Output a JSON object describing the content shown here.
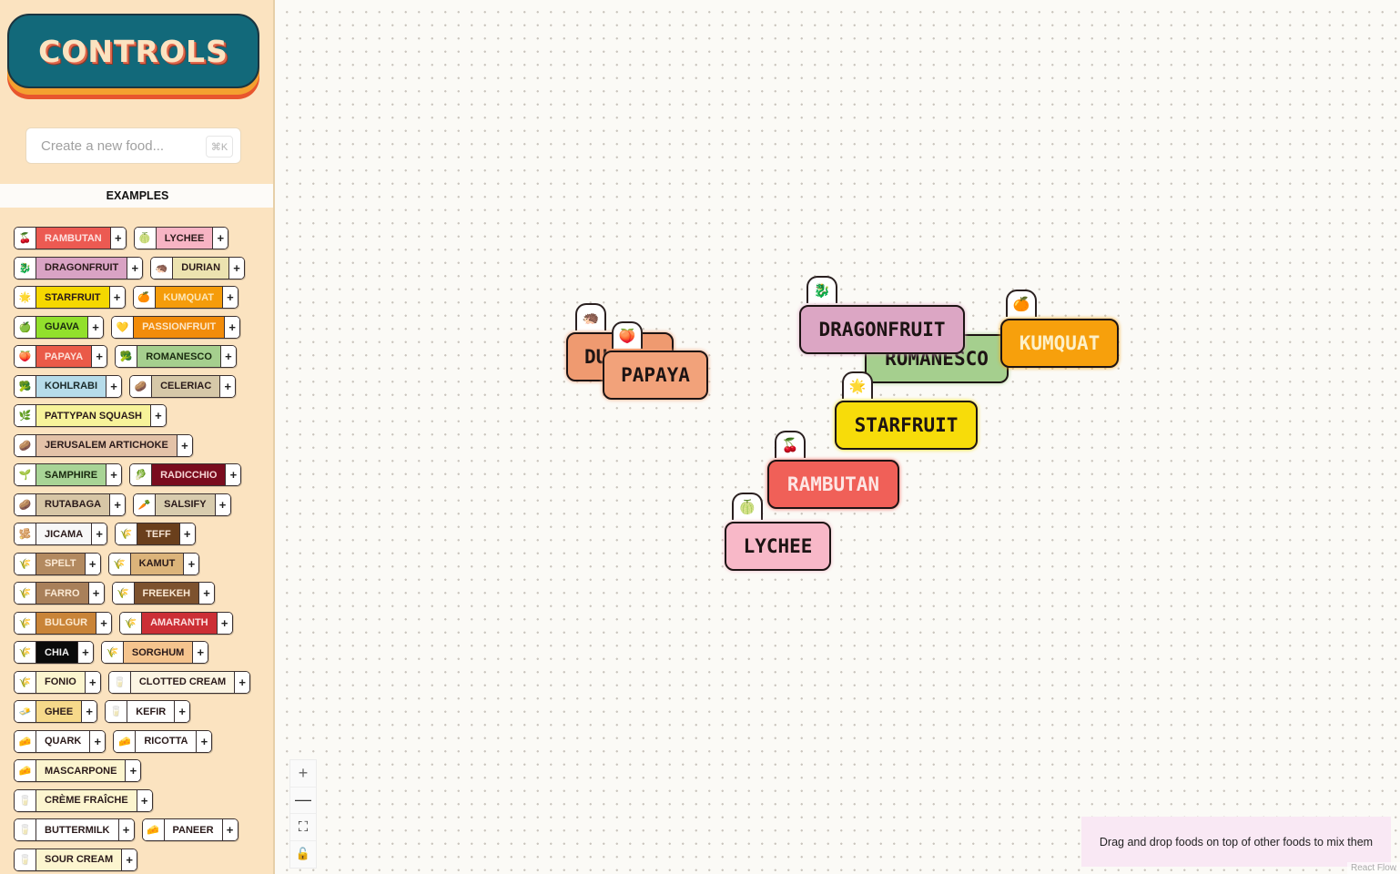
{
  "sidebar": {
    "logo": "CONTROLS",
    "search": {
      "placeholder": "Create a new food...",
      "value": "",
      "shortcut": "⌘K"
    },
    "examples_title": "EXAMPLES",
    "rows": [
      [
        {
          "label": "RAMBUTAN",
          "icon": "cherries-icon",
          "glyph": "🍒",
          "bg": "#ec5a52",
          "fg": "#fde2e0"
        },
        {
          "label": "LYCHEE",
          "icon": "melon-icon",
          "glyph": "🍈",
          "bg": "#f7b4c4",
          "fg": "#2a1a1a"
        }
      ],
      [
        {
          "label": "DRAGONFRUIT",
          "icon": "dragon-icon",
          "glyph": "🐉",
          "bg": "#d9a3c4",
          "fg": "#2a1a1a"
        },
        {
          "label": "DURIAN",
          "icon": "hedgehog-icon",
          "glyph": "🦔",
          "bg": "#ece3b0",
          "fg": "#2a1a1a"
        }
      ],
      [
        {
          "label": "STARFRUIT",
          "icon": "star-icon",
          "glyph": "🌟",
          "bg": "#f5d800",
          "fg": "#2a1a1a"
        },
        {
          "label": "KUMQUAT",
          "icon": "orange-icon",
          "glyph": "🍊",
          "bg": "#f59c0a",
          "fg": "#fde7b8"
        }
      ],
      [
        {
          "label": "GUAVA",
          "icon": "apple-icon",
          "glyph": "🍏",
          "bg": "#92e02c",
          "fg": "#1a2a10"
        },
        {
          "label": "PASSIONFRUIT",
          "icon": "heart-icon",
          "glyph": "💛",
          "bg": "#f28c0a",
          "fg": "#fde7c8"
        }
      ],
      [
        {
          "label": "PAPAYA",
          "icon": "peach-icon",
          "glyph": "🍑",
          "bg": "#ea5a48",
          "fg": "#fde0d8"
        },
        {
          "label": "ROMANESCO",
          "icon": "broccoli-icon",
          "glyph": "🥦",
          "bg": "#a5cf8e",
          "fg": "#1a2a10"
        }
      ],
      [
        {
          "label": "KOHLRABI",
          "icon": "broccoli-icon",
          "glyph": "🥦",
          "bg": "#b6dcea",
          "fg": "#1a2a2a"
        },
        {
          "label": "CELERIAC",
          "icon": "potato-icon",
          "glyph": "🥔",
          "bg": "#d6c8a8",
          "fg": "#2a1a1a"
        }
      ],
      [
        {
          "label": "PATTYPAN SQUASH",
          "icon": "leaf-icon",
          "glyph": "🌿",
          "bg": "#f7f39a",
          "fg": "#2a1a1a"
        }
      ],
      [
        {
          "label": "JERUSALEM ARTICHOKE",
          "icon": "potato-icon",
          "glyph": "🥔",
          "bg": "#e3c2a8",
          "fg": "#2a1a1a"
        }
      ],
      [
        {
          "label": "SAMPHIRE",
          "icon": "sprout-icon",
          "glyph": "🌱",
          "bg": "#a8d496",
          "fg": "#1a2a10"
        },
        {
          "label": "RADICCHIO",
          "icon": "lettuce-icon",
          "glyph": "🥬",
          "bg": "#7a0c1e",
          "fg": "#f7d6d6"
        }
      ],
      [
        {
          "label": "RUTABAGA",
          "icon": "potato-icon",
          "glyph": "🥔",
          "bg": "#d7c6a6",
          "fg": "#2a1a1a"
        },
        {
          "label": "SALSIFY",
          "icon": "carrot-icon",
          "glyph": "🥕",
          "bg": "#d8ccae",
          "fg": "#2a1a1a"
        }
      ],
      [
        {
          "label": "JICAMA",
          "icon": "root-icon",
          "glyph": "🫚",
          "bg": "#f7f7f7",
          "fg": "#2a1a1a"
        },
        {
          "label": "TEFF",
          "icon": "rice-icon",
          "glyph": "🌾",
          "bg": "#6a3f1c",
          "fg": "#f7e6d6"
        }
      ],
      [
        {
          "label": "SPELT",
          "icon": "rice-icon",
          "glyph": "🌾",
          "bg": "#b38a60",
          "fg": "#fbe9d4"
        },
        {
          "label": "KAMUT",
          "icon": "rice-icon",
          "glyph": "🌾",
          "bg": "#dcb47a",
          "fg": "#2a1a1a"
        }
      ],
      [
        {
          "label": "FARRO",
          "icon": "rice-icon",
          "glyph": "🌾",
          "bg": "#a9805a",
          "fg": "#fbe9d4"
        },
        {
          "label": "FREEKEH",
          "icon": "rice-icon",
          "glyph": "🌾",
          "bg": "#7d522e",
          "fg": "#fbe9d4"
        }
      ],
      [
        {
          "label": "BULGUR",
          "icon": "rice-icon",
          "glyph": "🌾",
          "bg": "#c98438",
          "fg": "#fde9cf"
        },
        {
          "label": "AMARANTH",
          "icon": "rice-icon",
          "glyph": "🌾",
          "bg": "#cc2f36",
          "fg": "#fde0e0"
        }
      ],
      [
        {
          "label": "CHIA",
          "icon": "rice-icon",
          "glyph": "🌾",
          "bg": "#0a0a0a",
          "fg": "#f2f2f2"
        },
        {
          "label": "SORGHUM",
          "icon": "rice-icon",
          "glyph": "🌾",
          "bg": "#f5c48e",
          "fg": "#2a1a1a"
        }
      ],
      [
        {
          "label": "FONIO",
          "icon": "rice-icon",
          "glyph": "🌾",
          "bg": "#fcf5cf",
          "fg": "#2a1a1a"
        },
        {
          "label": "CLOTTED CREAM",
          "icon": "glass-icon",
          "glyph": "🥛",
          "bg": "#fcf5e3",
          "fg": "#2a1a1a"
        }
      ],
      [
        {
          "label": "GHEE",
          "icon": "butter-icon",
          "glyph": "🧈",
          "bg": "#f6d98a",
          "fg": "#2a1a1a"
        },
        {
          "label": "KEFIR",
          "icon": "glass-icon",
          "glyph": "🥛",
          "bg": "#ffffff",
          "fg": "#2a1a1a"
        }
      ],
      [
        {
          "label": "QUARK",
          "icon": "cheese-icon",
          "glyph": "🧀",
          "bg": "#ffffff",
          "fg": "#2a1a1a"
        },
        {
          "label": "RICOTTA",
          "icon": "cheese-icon",
          "glyph": "🧀",
          "bg": "#ffffff",
          "fg": "#2a1a1a"
        }
      ],
      [
        {
          "label": "MASCARPONE",
          "icon": "cheese-icon",
          "glyph": "🧀",
          "bg": "#fcf5cf",
          "fg": "#2a1a1a"
        }
      ],
      [
        {
          "label": "CRÈME FRAÎCHE",
          "icon": "glass-icon",
          "glyph": "🥛",
          "bg": "#fcf5cf",
          "fg": "#2a1a1a"
        }
      ],
      [
        {
          "label": "BUTTERMILK",
          "icon": "glass-icon",
          "glyph": "🥛",
          "bg": "#ffffff",
          "fg": "#2a1a1a"
        },
        {
          "label": "PANEER",
          "icon": "cheese-icon",
          "glyph": "🧀",
          "bg": "#ffffff",
          "fg": "#2a1a1a"
        }
      ],
      [
        {
          "label": "SOUR CREAM",
          "icon": "glass-icon",
          "glyph": "🥛",
          "bg": "#fcf5cf",
          "fg": "#2a1a1a"
        }
      ]
    ],
    "add_label": "+"
  },
  "canvas": {
    "nodes": [
      {
        "label": "DURIAN",
        "display": "DU",
        "icon": "hedgehog-icon",
        "glyph": "🦔",
        "bg": "#ef9a70",
        "fg": "#1d1414"
      },
      {
        "label": "PAPAYA",
        "icon": "peach-icon",
        "glyph": "🍑",
        "bg": "#f2a27a",
        "fg": "#1d1414"
      },
      {
        "label": "ROMANESCO",
        "icon": "broccoli-icon",
        "glyph": "🥦",
        "bg": "#a5cf8e",
        "fg": "#1d1414"
      },
      {
        "label": "DRAGONFRUIT",
        "icon": "dragon-icon",
        "glyph": "🐉",
        "bg": "#dca6c4",
        "fg": "#1d1414"
      },
      {
        "label": "KUMQUAT",
        "icon": "orange-icon",
        "glyph": "🍊",
        "bg": "#f7a00c",
        "fg": "#fdf0c8"
      },
      {
        "label": "STARFRUIT",
        "icon": "star-icon",
        "glyph": "🌟",
        "bg": "#f7dc0a",
        "fg": "#1d1414"
      },
      {
        "label": "RAMBUTAN",
        "icon": "cherries-icon",
        "glyph": "🍒",
        "bg": "#f06058",
        "fg": "#fde6e4"
      },
      {
        "label": "LYCHEE",
        "icon": "melon-icon",
        "glyph": "🍈",
        "bg": "#f8b8c8",
        "fg": "#1d1414"
      }
    ],
    "controls": {
      "zoom_in": "+",
      "zoom_out": "—",
      "fit": "⛶",
      "lock": "🔓"
    },
    "hint": "Drag and drop foods on top of other foods to mix them",
    "attribution": "React Flow"
  }
}
